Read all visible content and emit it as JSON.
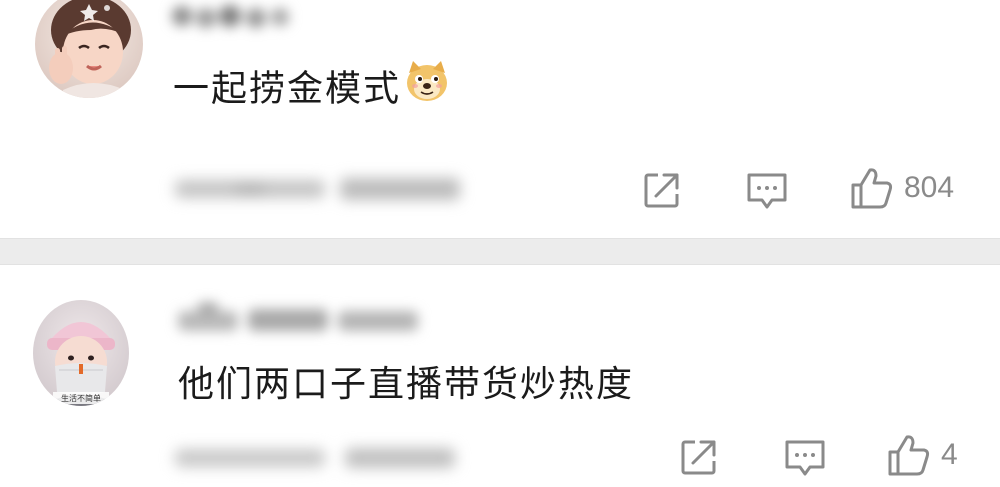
{
  "comments": [
    {
      "text": "一起捞金模式",
      "emoji": "doge-emoji",
      "likes": "804",
      "icons": [
        "share-icon",
        "reply-icon",
        "like-icon"
      ]
    },
    {
      "text": "他们两口子直播带货炒热度",
      "likes": "4",
      "avatar_badge": "生活不简单",
      "icons": [
        "share-icon",
        "reply-icon",
        "like-icon"
      ]
    }
  ],
  "colors": {
    "text": "#1b1b1b",
    "muted": "#8a8a8a",
    "separator": "#ececec"
  }
}
